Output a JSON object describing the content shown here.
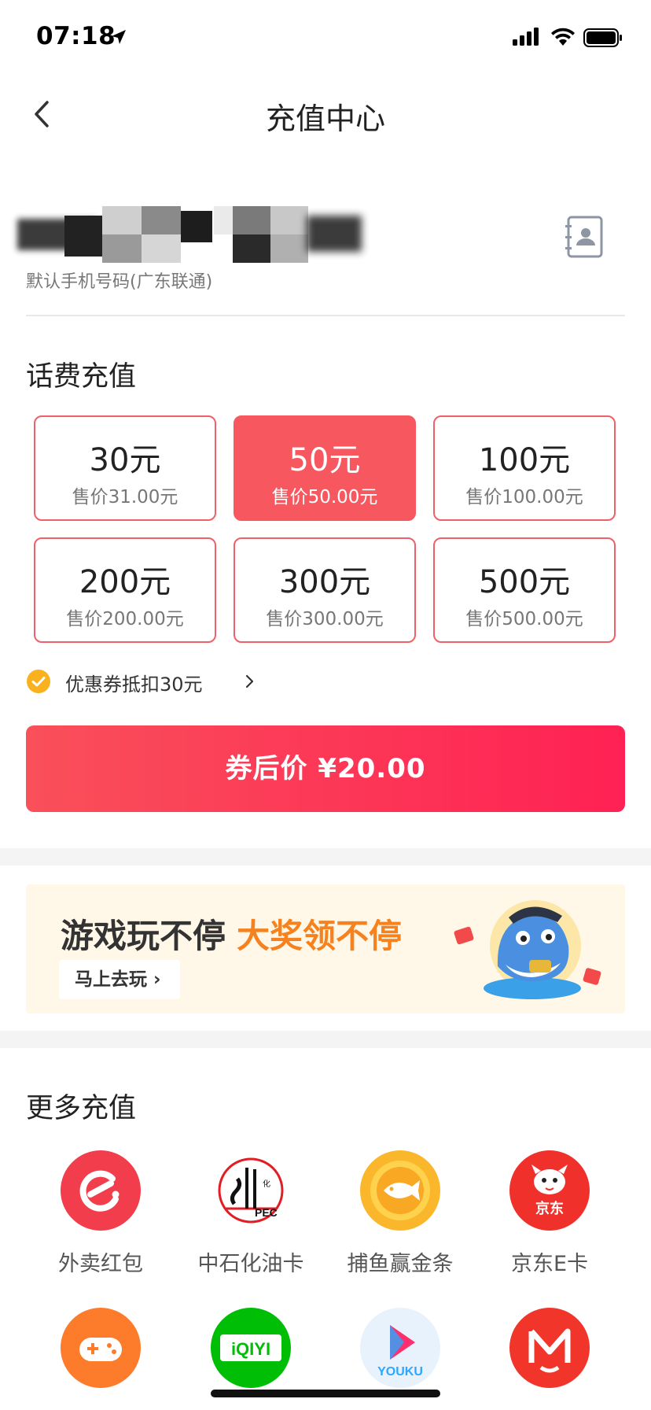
{
  "status_bar": {
    "time": "07:18"
  },
  "nav": {
    "title": "充值中心"
  },
  "phone": {
    "caption": "默认手机号码(广东联通)"
  },
  "recharge": {
    "title": "话费充值",
    "selected_index": 1,
    "options": [
      {
        "amount": "30元",
        "price": "售价31.00元"
      },
      {
        "amount": "50元",
        "price": "售价50.00元"
      },
      {
        "amount": "100元",
        "price": "售价100.00元"
      },
      {
        "amount": "200元",
        "price": "售价200.00元"
      },
      {
        "amount": "300元",
        "price": "售价300.00元"
      },
      {
        "amount": "500元",
        "price": "售价500.00元"
      }
    ],
    "coupon": "优惠券抵扣30元",
    "pay_button": "券后价 ¥20.00"
  },
  "banner": {
    "headline_a": "游戏玩不停",
    "headline_b": "大奖领不停",
    "button": "马上去玩 ›"
  },
  "more": {
    "title": "更多充值",
    "items": [
      {
        "label": "外卖红包",
        "icon": "eleme-icon"
      },
      {
        "label": "中石化油卡",
        "icon": "sinopec-icon"
      },
      {
        "label": "捕鱼赢金条",
        "icon": "fish-game-icon"
      },
      {
        "label": "京东E卡",
        "icon": "jd-icon"
      },
      {
        "label": "",
        "icon": "gamepad-icon"
      },
      {
        "label": "",
        "icon": "iqiyi-icon"
      },
      {
        "label": "",
        "icon": "youku-icon"
      },
      {
        "label": "",
        "icon": "mango-tv-icon"
      }
    ],
    "row2_text": {
      "iqiyi": "iQIYI",
      "youku": "YOUKU"
    }
  },
  "colors": {
    "accent": "#f7585f",
    "pay_gradient_start": "#f9505a",
    "pay_gradient_end": "#ff2154",
    "coupon_check": "#f9b21d",
    "banner_orange": "#f5821f",
    "banner_bg": "#fff8e8"
  }
}
